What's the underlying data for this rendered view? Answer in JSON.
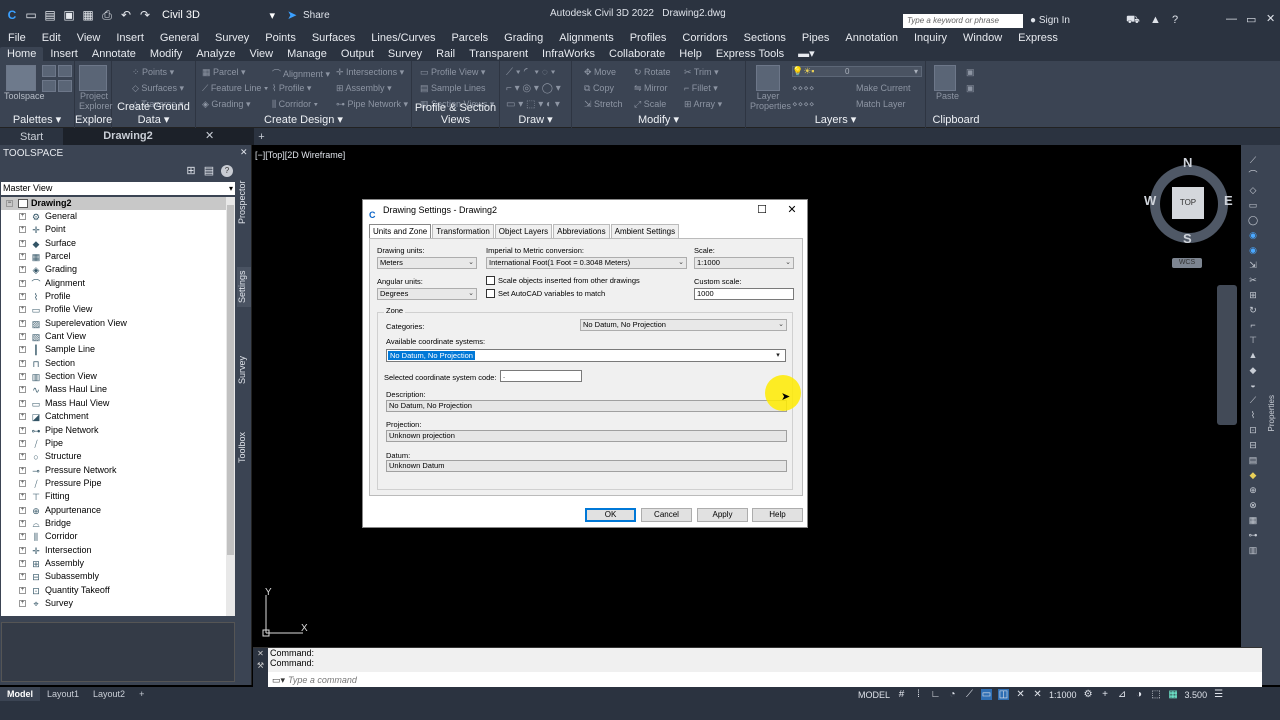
{
  "app": {
    "title": "Autodesk Civil 3D 2022",
    "document": "Drawing2.dwg",
    "workspace": "Civil 3D",
    "share": "Share",
    "search_placeholder": "Type a keyword or phrase",
    "sign_in": "Sign In"
  },
  "menu": [
    "File",
    "Edit",
    "View",
    "Insert",
    "General",
    "Survey",
    "Points",
    "Surfaces",
    "Lines/Curves",
    "Parcels",
    "Grading",
    "Alignments",
    "Profiles",
    "Corridors",
    "Sections",
    "Pipes",
    "Annotation",
    "Inquiry",
    "Window",
    "Express"
  ],
  "ribbon_tabs": [
    "Home",
    "Insert",
    "Annotate",
    "Modify",
    "Analyze",
    "View",
    "Manage",
    "Output",
    "Survey",
    "Rail",
    "Transparent",
    "InfraWorks",
    "Collaborate",
    "Help",
    "Express Tools"
  ],
  "ribbon_panels": {
    "palettes": "Palettes",
    "explore": "Explore",
    "ground": "Create Ground Data",
    "design": "Create Design",
    "profile": "Profile & Section Views",
    "draw": "Draw",
    "modify": "Modify",
    "layers": "Layers",
    "clipboard": "Clipboard"
  },
  "ribbon_buttons": {
    "toolspace": "Toolspace",
    "project_explorer": "Project Explorer",
    "points": "Points",
    "surfaces": "Surfaces",
    "traverse": "Traverse",
    "parcel": "Parcel",
    "feature_line": "Feature Line",
    "grading": "Grading",
    "alignment": "Alignment",
    "profile": "Profile",
    "corridor": "Corridor",
    "intersections": "Intersections",
    "assembly": "Assembly",
    "pipe_network": "Pipe Network",
    "profile_view": "Profile View",
    "sample_lines": "Sample Lines",
    "section_views": "Section Views",
    "move": "Move",
    "copy": "Copy",
    "stretch": "Stretch",
    "rotate": "Rotate",
    "mirror": "Mirror",
    "scale": "Scale",
    "trim": "Trim",
    "fillet": "Fillet",
    "array": "Array",
    "layer_properties": "Layer Properties",
    "make_current": "Make Current",
    "match_layer": "Match Layer",
    "layer_value": "0",
    "paste": "Paste"
  },
  "doc_tabs": [
    "Start",
    "Drawing2"
  ],
  "toolspace": {
    "title": "TOOLSPACE",
    "view": "Master View",
    "root": "Drawing2",
    "items": [
      "General",
      "Point",
      "Surface",
      "Parcel",
      "Grading",
      "Alignment",
      "Profile",
      "Profile View",
      "Superelevation View",
      "Cant View",
      "Sample Line",
      "Section",
      "Section View",
      "Mass Haul Line",
      "Mass Haul View",
      "Catchment",
      "Pipe Network",
      "Pipe",
      "Structure",
      "Pressure Network",
      "Pressure Pipe",
      "Fitting",
      "Appurtenance",
      "Bridge",
      "Corridor",
      "Intersection",
      "Assembly",
      "Subassembly",
      "Quantity Takeoff",
      "Survey"
    ],
    "side_tabs": [
      "Prospector",
      "Settings",
      "Survey",
      "Toolbox"
    ]
  },
  "viewport": {
    "label": "[−][Top][2D Wireframe]",
    "cube_top": "TOP",
    "n": "N",
    "s": "S",
    "e": "E",
    "w": "W",
    "wcs": "WCS",
    "ucs_x": "X",
    "ucs_y": "Y"
  },
  "properties_tab": "Properties",
  "dialog": {
    "title": "Drawing Settings - Drawing2",
    "tabs": [
      "Units and Zone",
      "Transformation",
      "Object Layers",
      "Abbreviations",
      "Ambient Settings"
    ],
    "drawing_units_label": "Drawing units:",
    "drawing_units": "Meters",
    "imperial_label": "Imperial to Metric conversion:",
    "imperial": "International Foot(1 Foot = 0.3048 Meters)",
    "scale_label": "Scale:",
    "scale": "1:1000",
    "angular_label": "Angular units:",
    "angular": "Degrees",
    "chk_scale": "Scale objects inserted from other drawings",
    "chk_autocad": "Set AutoCAD variables to match",
    "custom_scale_label": "Custom scale:",
    "custom_scale": "1000",
    "zone_label": "Zone",
    "categories_label": "Categories:",
    "categories": "No Datum, No Projection",
    "available_label": "Available coordinate systems:",
    "available": "No Datum, No Projection",
    "code_label": "Selected coordinate system code:",
    "code": ".",
    "description_label": "Description:",
    "description": "No Datum, No Projection",
    "projection_label": "Projection:",
    "projection": "Unknown projection",
    "datum_label": "Datum:",
    "datum": "Unknown Datum",
    "ok": "OK",
    "cancel": "Cancel",
    "apply": "Apply",
    "help": "Help"
  },
  "command": {
    "line1": "Command:",
    "line2": "Command:",
    "placeholder": "Type a command"
  },
  "status": {
    "tabs": [
      "Model",
      "Layout1",
      "Layout2"
    ],
    "model": "MODEL",
    "scale": "1:1000",
    "value": "3.500"
  }
}
